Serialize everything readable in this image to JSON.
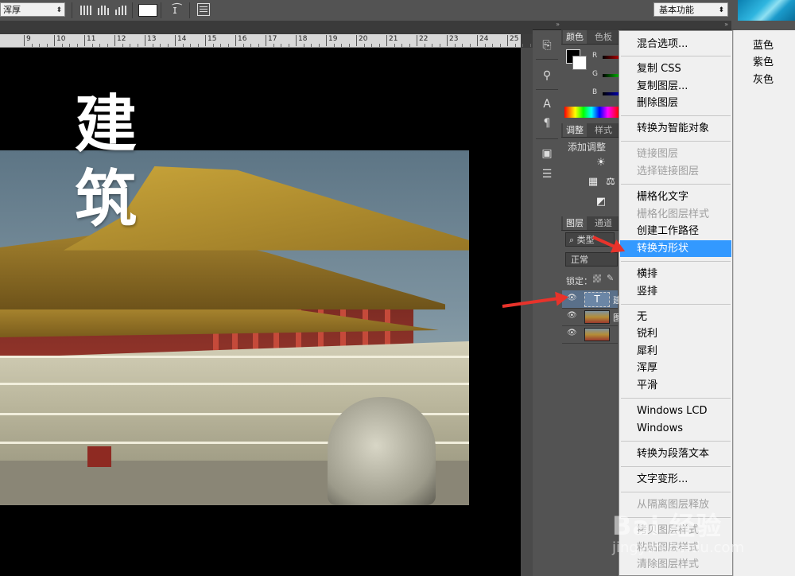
{
  "options_bar": {
    "antialias_value": "浑厚",
    "workspace_value": "基本功能"
  },
  "ruler": {
    "ticks": [
      "9",
      "10",
      "11",
      "12",
      "13",
      "14",
      "15",
      "16",
      "17",
      "18",
      "19",
      "20",
      "21",
      "22",
      "23",
      "24",
      "25"
    ]
  },
  "canvas": {
    "overlay_text_line1": "建",
    "overlay_text_line2": "筑"
  },
  "color_panel": {
    "tabs": [
      "颜色",
      "色板"
    ],
    "channels": [
      "R",
      "G",
      "B"
    ]
  },
  "adjustments_panel": {
    "tabs": [
      "调整",
      "样式"
    ],
    "title": "添加调整"
  },
  "layers_panel": {
    "tabs": [
      "图层",
      "通道"
    ],
    "filter_label": "类型",
    "blend_mode": "正常",
    "lock_label": "锁定：",
    "text_layer_glyph": "T",
    "rows": [
      {
        "name": "建"
      },
      {
        "name": "图"
      },
      {
        "name": ""
      }
    ]
  },
  "context_menu": {
    "items": [
      "混合选项...",
      "复制 CSS",
      "复制图层...",
      "删除图层",
      "转换为智能对象",
      "链接图层",
      "选择链接图层",
      "栅格化文字",
      "栅格化图层样式",
      "创建工作路径",
      "转换为形状",
      "横排",
      "竖排",
      "无",
      "锐利",
      "犀利",
      "浑厚",
      "平滑",
      "Windows LCD",
      "Windows",
      "转换为段落文本",
      "文字变形...",
      "从隔离图层释放",
      "拷贝图层样式",
      "粘贴图层样式",
      "清除图层样式"
    ]
  },
  "color_tags": [
    "蓝色",
    "紫色",
    "灰色"
  ],
  "watermark": {
    "main": "Bai 经验",
    "sub": "jingyan.baidu.com"
  },
  "colors": {
    "menu_highlight": "#3399ff",
    "arrow": "#e8332b",
    "panel_bg": "#535353"
  }
}
